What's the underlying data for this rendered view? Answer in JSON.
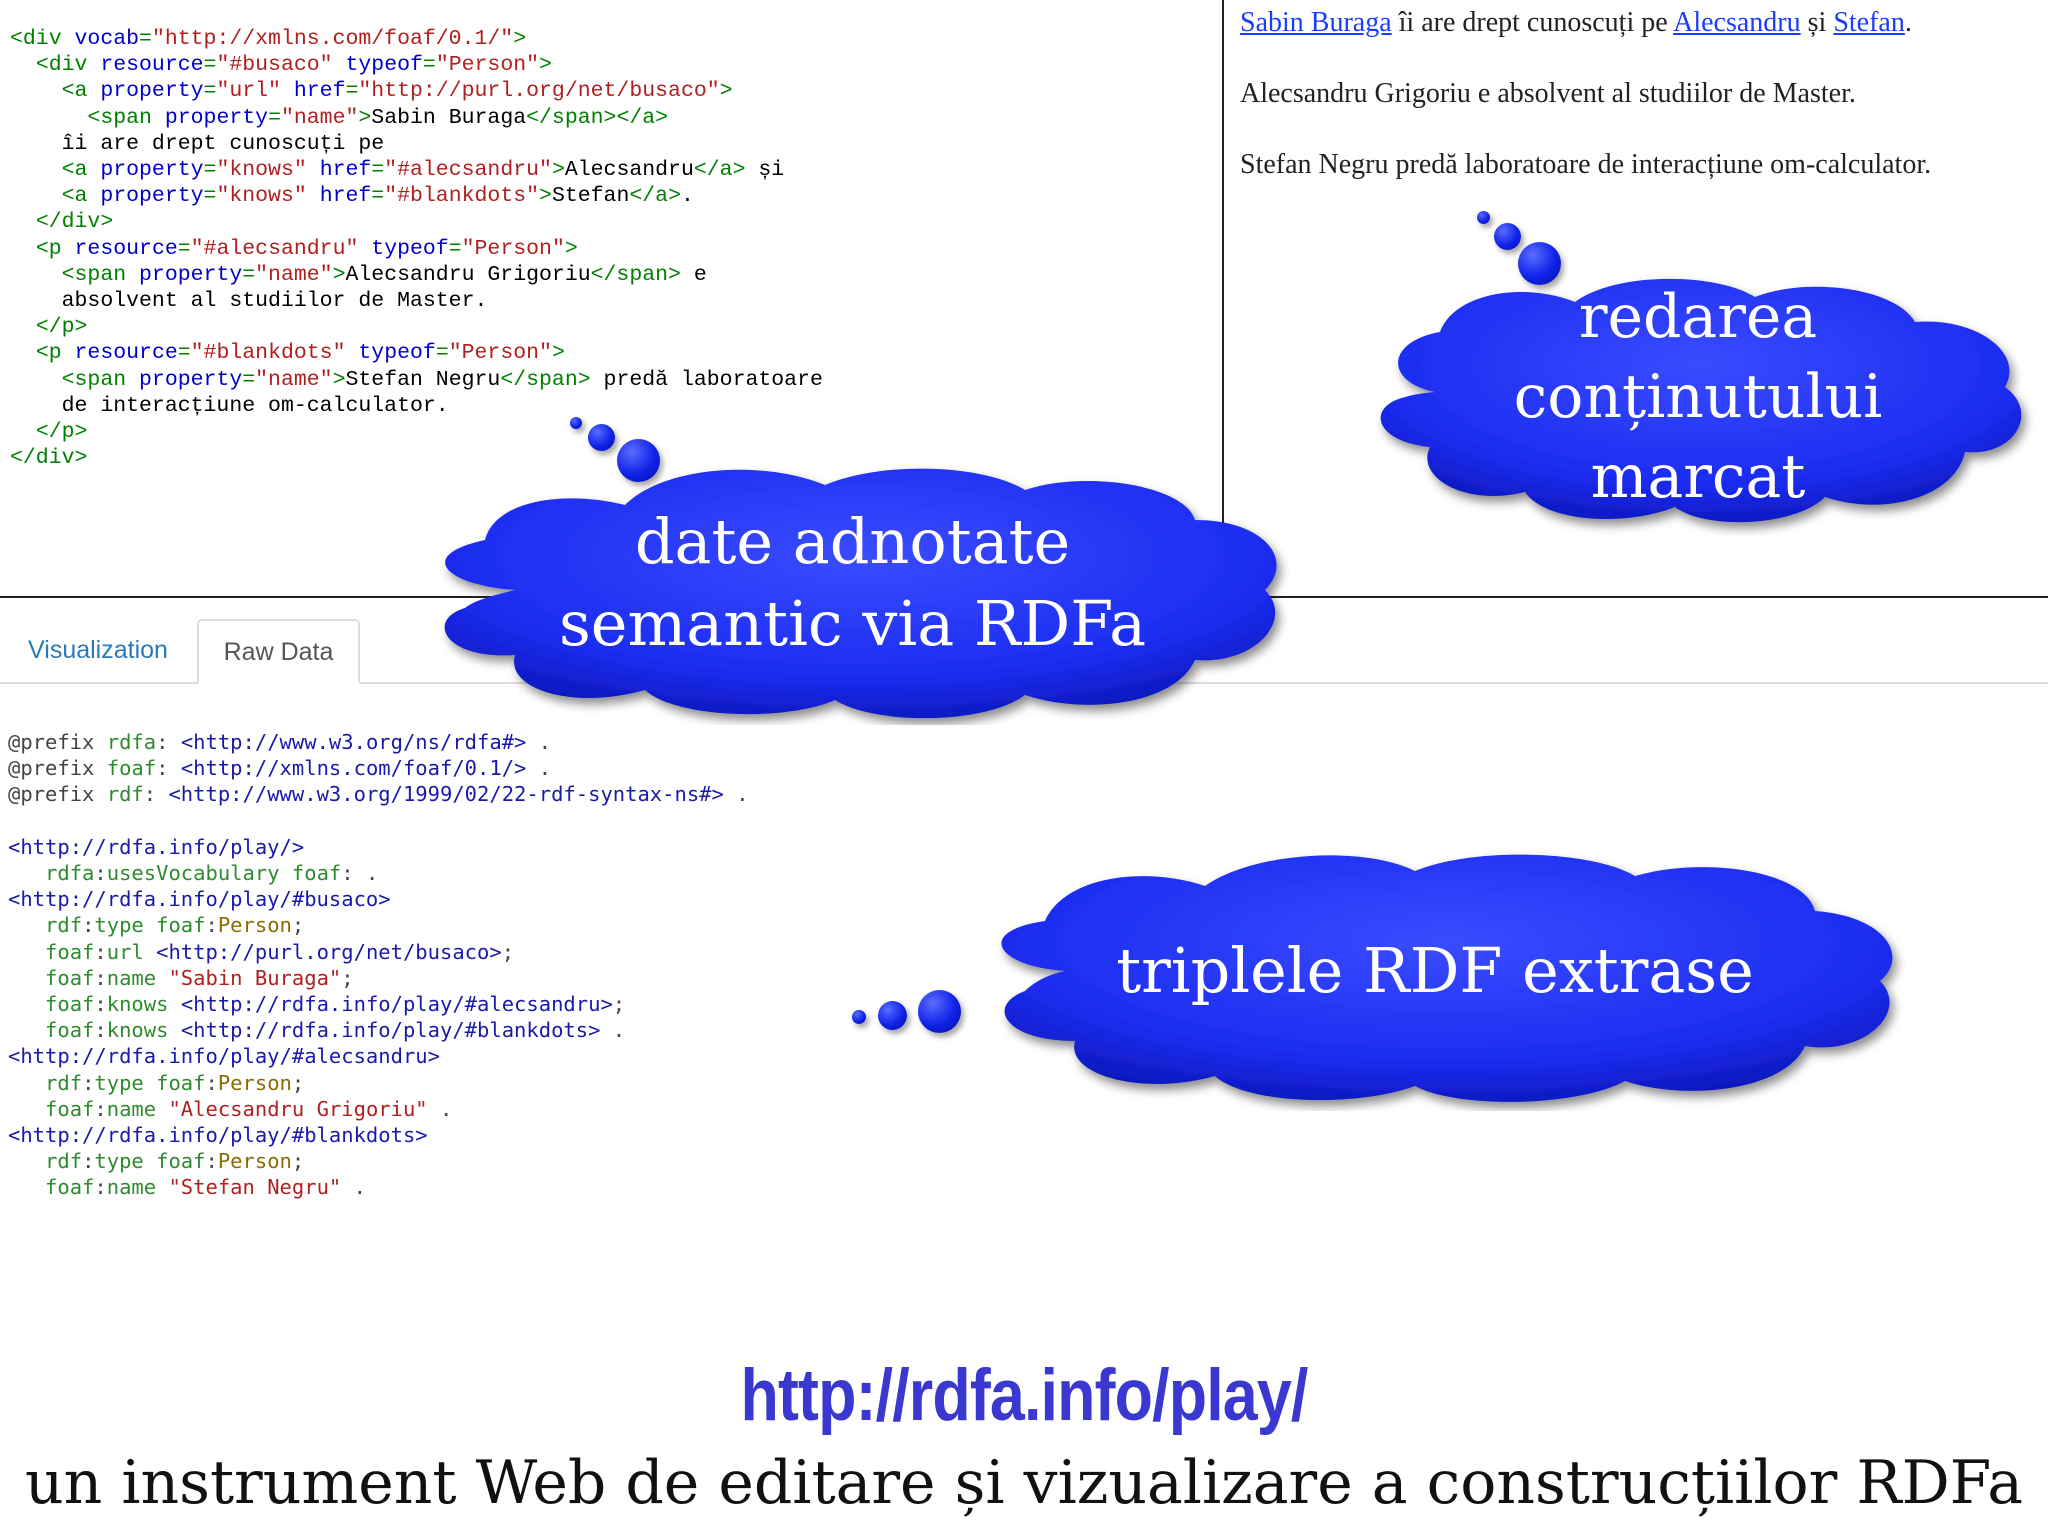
{
  "html_source": [
    [
      [
        "tag",
        "<div "
      ],
      [
        "attr",
        "vocab"
      ],
      [
        "tag",
        "="
      ],
      [
        "val",
        "\"http://xmlns.com/foaf/0.1/\""
      ],
      [
        "tag",
        ">"
      ]
    ],
    [
      [
        "t",
        "  "
      ],
      [
        "tag",
        "<div "
      ],
      [
        "attr",
        "resource"
      ],
      [
        "tag",
        "="
      ],
      [
        "val",
        "\"#busaco\""
      ],
      [
        "t",
        " "
      ],
      [
        "attr",
        "typeof"
      ],
      [
        "tag",
        "="
      ],
      [
        "val",
        "\"Person\""
      ],
      [
        "tag",
        ">"
      ]
    ],
    [
      [
        "t",
        "    "
      ],
      [
        "tag",
        "<a "
      ],
      [
        "attr",
        "property"
      ],
      [
        "tag",
        "="
      ],
      [
        "val",
        "\"url\""
      ],
      [
        "t",
        " "
      ],
      [
        "attr",
        "href"
      ],
      [
        "tag",
        "="
      ],
      [
        "val",
        "\"http://purl.org/net/busaco\""
      ],
      [
        "tag",
        ">"
      ]
    ],
    [
      [
        "t",
        "      "
      ],
      [
        "tag",
        "<span "
      ],
      [
        "attr",
        "property"
      ],
      [
        "tag",
        "="
      ],
      [
        "val",
        "\"name\""
      ],
      [
        "tag",
        ">"
      ],
      [
        "t",
        "Sabin Buraga"
      ],
      [
        "tag",
        "</span></a>"
      ]
    ],
    [
      [
        "t",
        "    îi are drept cunoscuți pe"
      ]
    ],
    [
      [
        "t",
        "    "
      ],
      [
        "tag",
        "<a "
      ],
      [
        "attr",
        "property"
      ],
      [
        "tag",
        "="
      ],
      [
        "val",
        "\"knows\""
      ],
      [
        "t",
        " "
      ],
      [
        "attr",
        "href"
      ],
      [
        "tag",
        "="
      ],
      [
        "val",
        "\"#alecsandru\""
      ],
      [
        "tag",
        ">"
      ],
      [
        "t",
        "Alecsandru"
      ],
      [
        "tag",
        "</a>"
      ],
      [
        "t",
        " și"
      ]
    ],
    [
      [
        "t",
        "    "
      ],
      [
        "tag",
        "<a "
      ],
      [
        "attr",
        "property"
      ],
      [
        "tag",
        "="
      ],
      [
        "val",
        "\"knows\""
      ],
      [
        "t",
        " "
      ],
      [
        "attr",
        "href"
      ],
      [
        "tag",
        "="
      ],
      [
        "val",
        "\"#blankdots\""
      ],
      [
        "tag",
        ">"
      ],
      [
        "t",
        "Stefan"
      ],
      [
        "tag",
        "</a>"
      ],
      [
        "t",
        "."
      ]
    ],
    [
      [
        "t",
        "  "
      ],
      [
        "tag",
        "</div>"
      ]
    ],
    [
      [
        "t",
        "  "
      ],
      [
        "tag",
        "<p "
      ],
      [
        "attr",
        "resource"
      ],
      [
        "tag",
        "="
      ],
      [
        "val",
        "\"#alecsandru\""
      ],
      [
        "t",
        " "
      ],
      [
        "attr",
        "typeof"
      ],
      [
        "tag",
        "="
      ],
      [
        "val",
        "\"Person\""
      ],
      [
        "tag",
        ">"
      ]
    ],
    [
      [
        "t",
        "    "
      ],
      [
        "tag",
        "<span "
      ],
      [
        "attr",
        "property"
      ],
      [
        "tag",
        "="
      ],
      [
        "val",
        "\"name\""
      ],
      [
        "tag",
        ">"
      ],
      [
        "t",
        "Alecsandru Grigoriu"
      ],
      [
        "tag",
        "</span>"
      ],
      [
        "t",
        " e"
      ]
    ],
    [
      [
        "t",
        "    absolvent al studiilor de Master."
      ]
    ],
    [
      [
        "t",
        "  "
      ],
      [
        "tag",
        "</p>"
      ]
    ],
    [
      [
        "t",
        "  "
      ],
      [
        "tag",
        "<p "
      ],
      [
        "attr",
        "resource"
      ],
      [
        "tag",
        "="
      ],
      [
        "val",
        "\"#blankdots\""
      ],
      [
        "t",
        " "
      ],
      [
        "attr",
        "typeof"
      ],
      [
        "tag",
        "="
      ],
      [
        "val",
        "\"Person\""
      ],
      [
        "tag",
        ">"
      ]
    ],
    [
      [
        "t",
        "    "
      ],
      [
        "tag",
        "<span "
      ],
      [
        "attr",
        "property"
      ],
      [
        "tag",
        "="
      ],
      [
        "val",
        "\"name\""
      ],
      [
        "tag",
        ">"
      ],
      [
        "t",
        "Stefan Negru"
      ],
      [
        "tag",
        "</span>"
      ],
      [
        "t",
        " predă laboratoare"
      ]
    ],
    [
      [
        "t",
        "    de interacțiune om-calculator."
      ]
    ],
    [
      [
        "t",
        "  "
      ],
      [
        "tag",
        "</p>"
      ]
    ],
    [
      [
        "tag",
        "</div>"
      ]
    ]
  ],
  "rendered": {
    "line1": {
      "link1": "Sabin Buraga",
      "text1": " îi are drept cunoscuți pe ",
      "link2": "Alecsandru",
      "text2": " și ",
      "link3": "Stefan",
      "text3": "."
    },
    "line2": "Alecsandru Grigoriu e absolvent al studiilor de Master.",
    "line3": "Stefan Negru predă laboratoare de interacțiune om-calculator."
  },
  "tabs": {
    "visualization": "Visualization",
    "raw_data": "Raw Data"
  },
  "turtle_source": [
    [
      [
        "t-pre",
        "@prefix "
      ],
      [
        "t-ns",
        "rdfa"
      ],
      [
        "t-pre",
        ": "
      ],
      [
        "t-uri",
        "<http://www.w3.org/ns/rdfa#>"
      ],
      [
        "t-pre",
        " ."
      ]
    ],
    [
      [
        "t-pre",
        "@prefix "
      ],
      [
        "t-ns",
        "foaf"
      ],
      [
        "t-pre",
        ": "
      ],
      [
        "t-uri",
        "<http://xmlns.com/foaf/0.1/>"
      ],
      [
        "t-pre",
        " ."
      ]
    ],
    [
      [
        "t-pre",
        "@prefix "
      ],
      [
        "t-ns",
        "rdf"
      ],
      [
        "t-pre",
        ": "
      ],
      [
        "t-uri",
        "<http://www.w3.org/1999/02/22-rdf-syntax-ns#>"
      ],
      [
        "t-pre",
        " ."
      ]
    ],
    [
      [
        "t-pre",
        ""
      ]
    ],
    [
      [
        "t-uri",
        "<http://rdfa.info/play/>"
      ]
    ],
    [
      [
        "t-pre",
        "   "
      ],
      [
        "t-ns",
        "rdfa"
      ],
      [
        "t-pre",
        ":"
      ],
      [
        "t-ns",
        "usesVocabulary"
      ],
      [
        "t-pre",
        " "
      ],
      [
        "t-ns",
        "foaf"
      ],
      [
        "t-pre",
        ": ."
      ]
    ],
    [
      [
        "t-uri",
        "<http://rdfa.info/play/#busaco>"
      ]
    ],
    [
      [
        "t-pre",
        "   "
      ],
      [
        "t-ns",
        "rdf"
      ],
      [
        "t-pre",
        ":"
      ],
      [
        "t-ns",
        "type"
      ],
      [
        "t-pre",
        " "
      ],
      [
        "t-ns",
        "foaf"
      ],
      [
        "t-pre",
        ":"
      ],
      [
        "t-kw",
        "Person"
      ],
      [
        "t-pre",
        ";"
      ]
    ],
    [
      [
        "t-pre",
        "   "
      ],
      [
        "t-ns",
        "foaf"
      ],
      [
        "t-pre",
        ":"
      ],
      [
        "t-ns",
        "url"
      ],
      [
        "t-pre",
        " "
      ],
      [
        "t-uri",
        "<http://purl.org/net/busaco>"
      ],
      [
        "t-pre",
        ";"
      ]
    ],
    [
      [
        "t-pre",
        "   "
      ],
      [
        "t-ns",
        "foaf"
      ],
      [
        "t-pre",
        ":"
      ],
      [
        "t-ns",
        "name"
      ],
      [
        "t-pre",
        " "
      ],
      [
        "t-str",
        "\"Sabin Buraga\""
      ],
      [
        "t-pre",
        ";"
      ]
    ],
    [
      [
        "t-pre",
        "   "
      ],
      [
        "t-ns",
        "foaf"
      ],
      [
        "t-pre",
        ":"
      ],
      [
        "t-ns",
        "knows"
      ],
      [
        "t-pre",
        " "
      ],
      [
        "t-uri",
        "<http://rdfa.info/play/#alecsandru>"
      ],
      [
        "t-pre",
        ";"
      ]
    ],
    [
      [
        "t-pre",
        "   "
      ],
      [
        "t-ns",
        "foaf"
      ],
      [
        "t-pre",
        ":"
      ],
      [
        "t-ns",
        "knows"
      ],
      [
        "t-pre",
        " "
      ],
      [
        "t-uri",
        "<http://rdfa.info/play/#blankdots>"
      ],
      [
        "t-pre",
        " ."
      ]
    ],
    [
      [
        "t-uri",
        "<http://rdfa.info/play/#alecsandru>"
      ]
    ],
    [
      [
        "t-pre",
        "   "
      ],
      [
        "t-ns",
        "rdf"
      ],
      [
        "t-pre",
        ":"
      ],
      [
        "t-ns",
        "type"
      ],
      [
        "t-pre",
        " "
      ],
      [
        "t-ns",
        "foaf"
      ],
      [
        "t-pre",
        ":"
      ],
      [
        "t-kw",
        "Person"
      ],
      [
        "t-pre",
        ";"
      ]
    ],
    [
      [
        "t-pre",
        "   "
      ],
      [
        "t-ns",
        "foaf"
      ],
      [
        "t-pre",
        ":"
      ],
      [
        "t-ns",
        "name"
      ],
      [
        "t-pre",
        " "
      ],
      [
        "t-str",
        "\"Alecsandru Grigoriu\""
      ],
      [
        "t-pre",
        " ."
      ]
    ],
    [
      [
        "t-uri",
        "<http://rdfa.info/play/#blankdots>"
      ]
    ],
    [
      [
        "t-pre",
        "   "
      ],
      [
        "t-ns",
        "rdf"
      ],
      [
        "t-pre",
        ":"
      ],
      [
        "t-ns",
        "type"
      ],
      [
        "t-pre",
        " "
      ],
      [
        "t-ns",
        "foaf"
      ],
      [
        "t-pre",
        ":"
      ],
      [
        "t-kw",
        "Person"
      ],
      [
        "t-pre",
        ";"
      ]
    ],
    [
      [
        "t-pre",
        "   "
      ],
      [
        "t-ns",
        "foaf"
      ],
      [
        "t-pre",
        ":"
      ],
      [
        "t-ns",
        "name"
      ],
      [
        "t-pre",
        " "
      ],
      [
        "t-str",
        "\"Stefan Negru\""
      ],
      [
        "t-pre",
        " ."
      ]
    ]
  ],
  "callouts": {
    "annotated": [
      "date adnotate",
      "semantic via RDFa"
    ],
    "rendering": [
      "redarea",
      "conținutului",
      "marcat"
    ],
    "triples": [
      "triplele RDF extrase"
    ]
  },
  "cloud_color": "#1c2cf0",
  "footer": {
    "url": "http://rdfa.info/play/",
    "caption": "un instrument Web de editare și vizualizare a construcțiilor RDFa"
  }
}
